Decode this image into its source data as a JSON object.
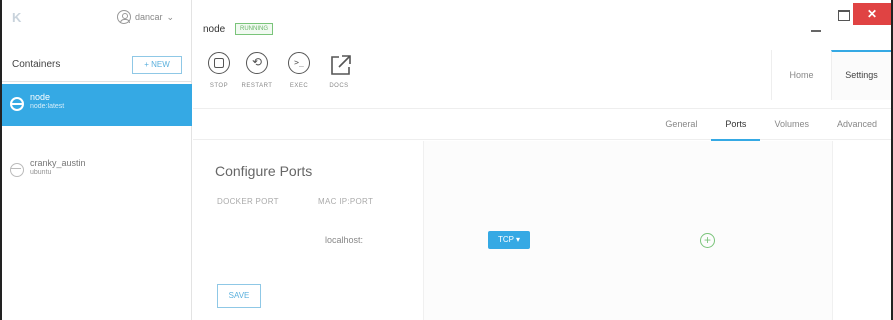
{
  "app": {
    "logo": "K",
    "user": "dancar",
    "window_controls": {
      "minimize": "—",
      "maximize": "",
      "close": "✕"
    }
  },
  "sidebar": {
    "title": "Containers",
    "new_button": "+ NEW",
    "items": [
      {
        "name": "node",
        "image": "node:latest",
        "active": true
      },
      {
        "name": "cranky_austin",
        "image": "ubuntu",
        "active": false
      }
    ]
  },
  "header": {
    "container_name": "node",
    "status_badge": "RUNNING"
  },
  "toolbar": {
    "stop": "STOP",
    "restart": "RESTART",
    "exec": "EXEC",
    "docs": "DOCS"
  },
  "topnav": {
    "home": "Home",
    "settings": "Settings"
  },
  "subtabs": [
    "General",
    "Ports",
    "Volumes",
    "Advanced"
  ],
  "ports": {
    "title": "Configure Ports",
    "col_docker": "DOCKER PORT",
    "col_mac": "MAC IP:PORT",
    "host": "localhost:",
    "protocol": "TCP ▾",
    "add": "+",
    "save": "SAVE"
  },
  "colors": {
    "accent": "#35a9e4",
    "running": "#7ac47a",
    "close": "#e04343"
  }
}
